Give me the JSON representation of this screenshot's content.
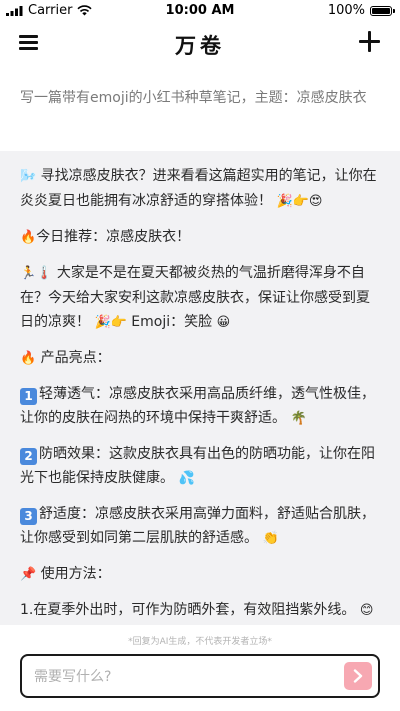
{
  "status_bar": {
    "carrier": "Carrier",
    "time": "10:00 AM",
    "battery": "100%"
  },
  "nav": {
    "title": "万卷"
  },
  "prompt": {
    "text": "写一篇带有emoji的小红书种草笔记，主题：凉感皮肤衣"
  },
  "response": {
    "p1": "寻找凉感皮肤衣？进来看看这篇超实用的笔记，让你在炎炎夏日也能拥有冰凉舒适的穿搭体验！",
    "p2": "今日推荐：凉感皮肤衣！",
    "p3": "大家是不是在夏天都被炎热的气温折磨得浑身不自在？今天给大家安利这款凉感皮肤衣，保证让你感受到夏日的凉爽！",
    "p3_tail": "Emoji：笑脸",
    "p4": "产品亮点：",
    "item1_num": "1",
    "item1": "轻薄透气：凉感皮肤衣采用高品质纤维，透气性极佳，让你的皮肤在闷热的环境中保持干爽舒适。",
    "item2_num": "2",
    "item2": "防晒效果：这款皮肤衣具有出色的防晒功能，让你在阳光下也能保持皮肤健康。",
    "item3_num": "3",
    "item3": "舒适度：凉感皮肤衣采用高弹力面料，舒适贴合肌肤，让你感受到如同第二层肌肤的舒适感。",
    "p5": "使用方法：",
    "p6": "1.在夏季外出时，可作为防晒外套，有效阻挡紫外线。"
  },
  "disclaimer": "*回复为AI生成，不代表开发者立场*",
  "input": {
    "placeholder": "需要写什么?",
    "value": ""
  },
  "colors": {
    "send_button": "#f7a8b2",
    "card_bg": "#f2f2f4",
    "number_badge": "#4a89dc"
  },
  "icons": {
    "menu": "hamburger-icon",
    "add": "plus-icon",
    "send": "chevron-right-icon",
    "wifi": "wifi-icon",
    "battery": "battery-icon",
    "signal": "signal-icon"
  }
}
